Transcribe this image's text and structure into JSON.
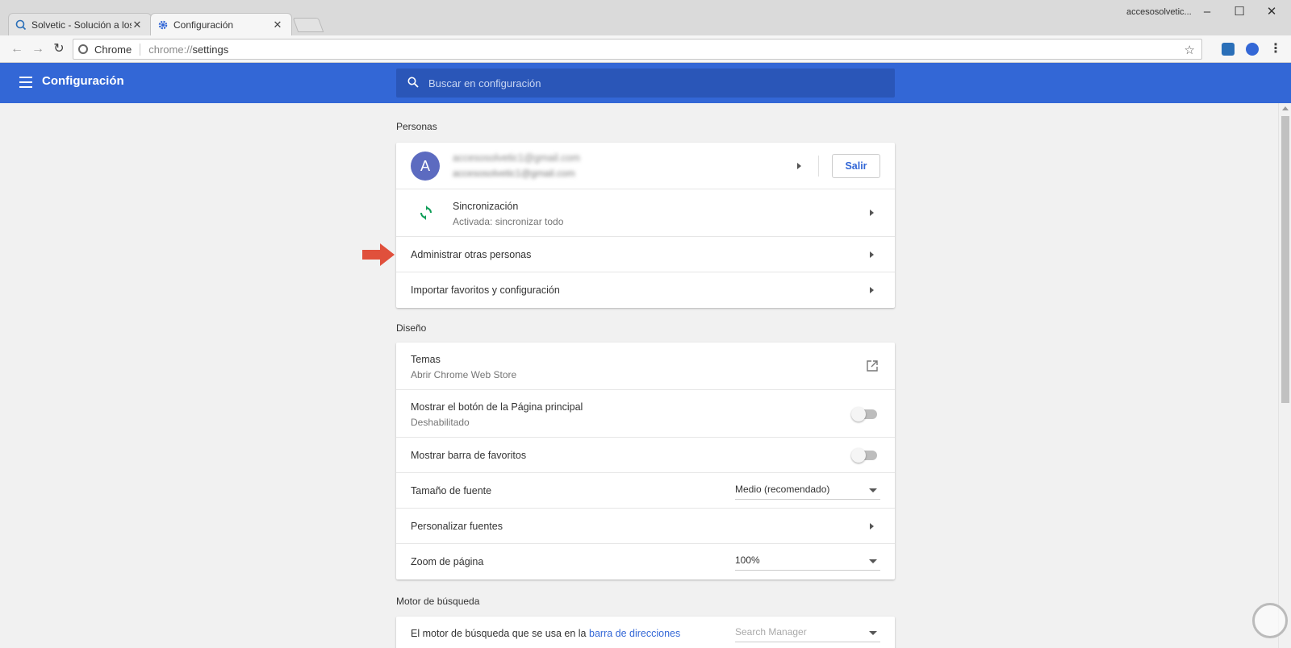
{
  "browser": {
    "tabs": [
      {
        "label": "Solvetic - Solución a los p",
        "favicon": "solvetic-icon"
      },
      {
        "label": "Configuración",
        "favicon": "gear-icon"
      }
    ],
    "profile_name": "accesosolvetic...",
    "window_controls": {
      "minimize": "–",
      "maximize": "☐",
      "close": "✕"
    },
    "omnibox": {
      "site": "Chrome",
      "url_dim": "chrome://",
      "url_main": "settings"
    }
  },
  "settings": {
    "title": "Configuración",
    "search_placeholder": "Buscar en configuración",
    "sections": {
      "personas": {
        "title": "Personas",
        "account": {
          "avatar_letter": "A",
          "name": "accesosolvetic1@gmail.com",
          "email": "accesosolvetic1@gmail.com",
          "signout_label": "Salir"
        },
        "sync": {
          "label": "Sincronización",
          "status": "Activada: sincronizar todo"
        },
        "manage_people": "Administrar otras personas",
        "import": "Importar favoritos y configuración"
      },
      "diseno": {
        "title": "Diseño",
        "themes": {
          "label": "Temas",
          "sub": "Abrir Chrome Web Store"
        },
        "home_button": {
          "label": "Mostrar el botón de la Página principal",
          "sub": "Deshabilitado",
          "on": false
        },
        "bookmarks_bar": {
          "label": "Mostrar barra de favoritos",
          "on": false
        },
        "font_size": {
          "label": "Tamaño de fuente",
          "value": "Medio (recomendado)"
        },
        "customize_fonts": "Personalizar fuentes",
        "page_zoom": {
          "label": "Zoom de página",
          "value": "100%"
        }
      },
      "motor": {
        "title": "Motor de búsqueda",
        "row_text": "El motor de búsqueda que se usa en la",
        "row_link": "barra de direcciones",
        "value": "Search Manager"
      }
    }
  },
  "colors": {
    "header_blue": "#3367d6",
    "arrow_red": "#e0503c",
    "sync_green": "#0f9d58"
  }
}
